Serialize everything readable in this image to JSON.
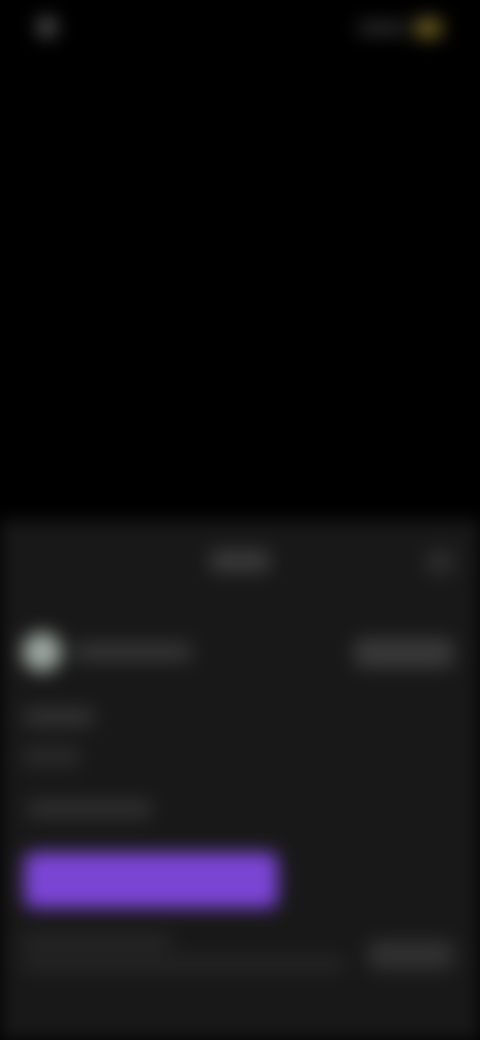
{
  "theme": {
    "background": "#000000",
    "sheet_background": "#181818",
    "accent": "#7b45d4"
  },
  "status_bar": {
    "time": "",
    "left_icon": "status-indicator-icon",
    "right_icons": [
      "signal-icon",
      "battery-icon"
    ]
  },
  "video": {
    "state": "blank"
  },
  "sheet": {
    "title": "",
    "close_icon": "close-icon",
    "channel": {
      "avatar_icon": "avatar",
      "name": "",
      "follow_label": ""
    },
    "info_lines": [
      "",
      "",
      ""
    ],
    "primary_label": "",
    "footer": {
      "line_1": "",
      "line_2": "",
      "button_label": ""
    }
  }
}
